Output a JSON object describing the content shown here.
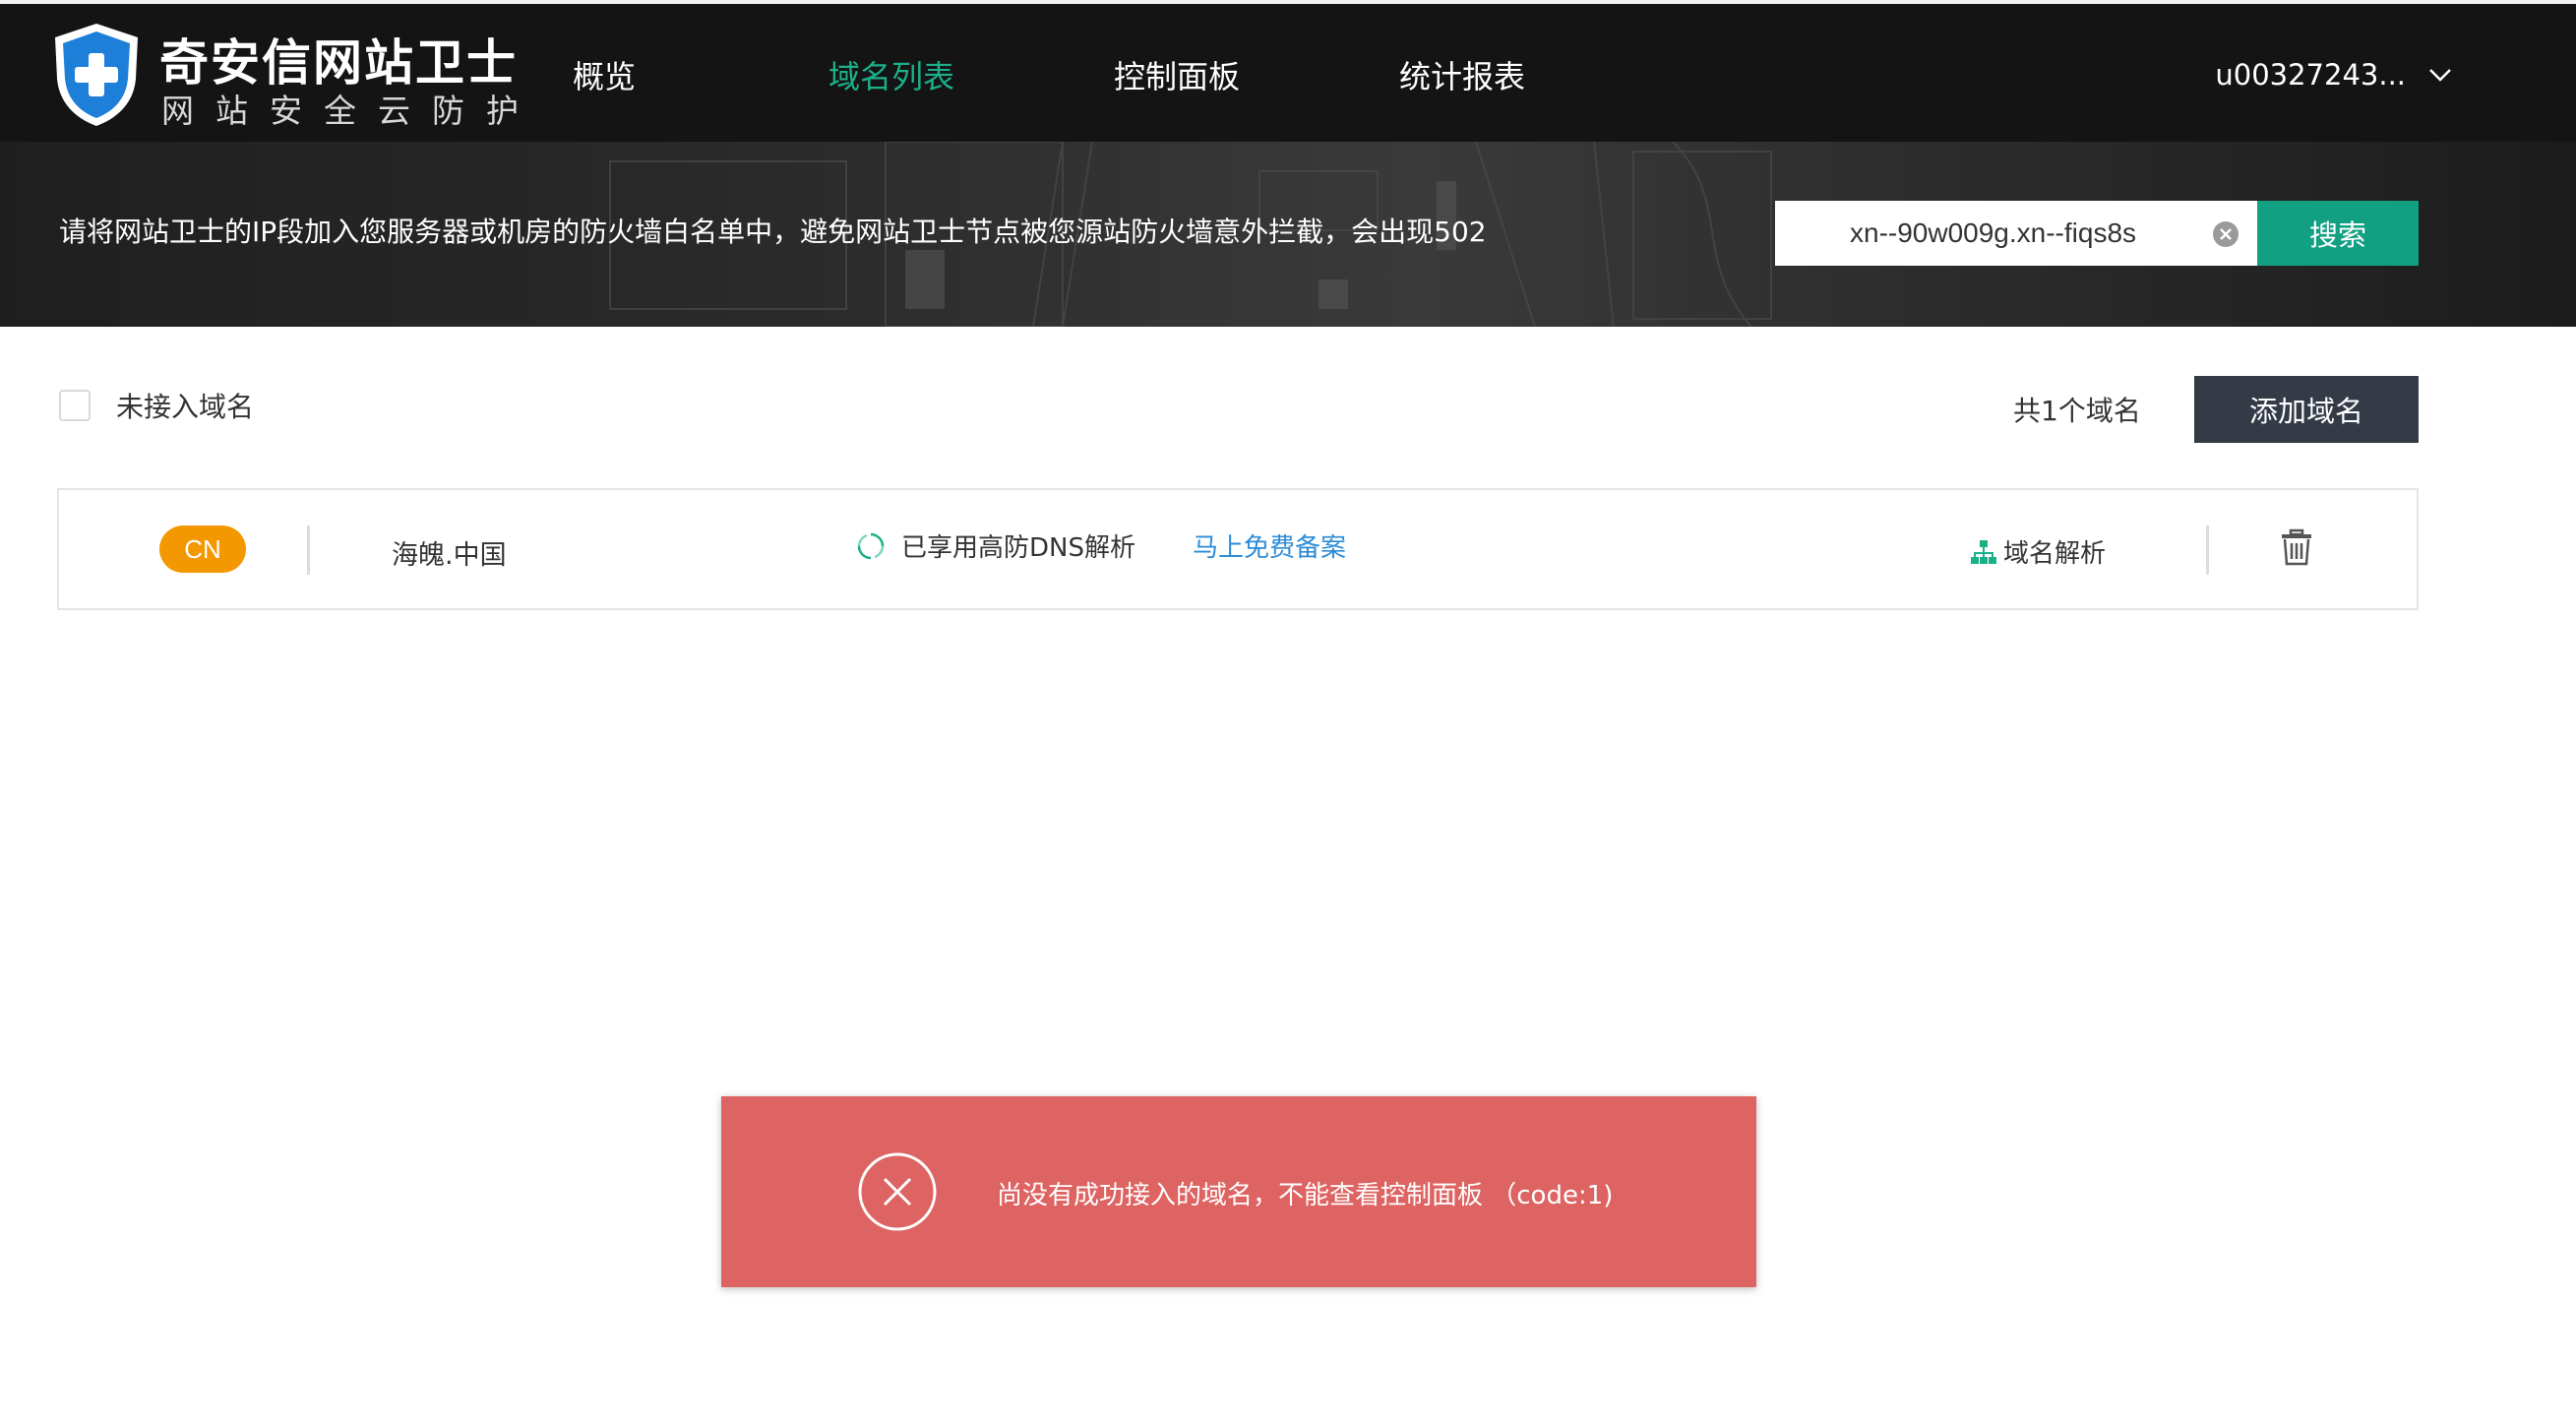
{
  "header": {
    "logo_title": "奇安信网站卫士",
    "logo_subtitle": "网站安全云防护",
    "nav": [
      {
        "label": "概览",
        "active": false
      },
      {
        "label": "域名列表",
        "active": true
      },
      {
        "label": "控制面板",
        "active": false
      },
      {
        "label": "统计报表",
        "active": false
      }
    ],
    "user_name": "u00327243..."
  },
  "banner": {
    "notice": "请将网站卫士的IP段加入您服务器或机房的防火墙白名单中，避免网站卫士节点被您源站防火墙意外拦截，会出现502",
    "search_value": "xn--90w009g.xn--fiqs8s",
    "search_button": "搜索"
  },
  "toolbar": {
    "unconnected_label": "未接入域名",
    "domain_count": "共1个域名",
    "add_domain_button": "添加域名"
  },
  "domains": [
    {
      "tld_badge": "CN",
      "name": "海魄.中国",
      "dns_status": "已享用高防DNS解析",
      "beian_link": "马上免费备案",
      "resolve_label": "域名解析"
    }
  ],
  "toast": {
    "message": "尚没有成功接入的域名，不能查看控制面板 （code:1)"
  },
  "colors": {
    "accent_green": "#1bb08a",
    "search_button": "#12a083",
    "add_button": "#343b47",
    "badge_orange": "#f39800",
    "link_blue": "#2d8cd6",
    "toast_red": "#dd6462"
  },
  "icons": [
    "shield-logo-icon",
    "chevron-down-icon",
    "clear-icon",
    "refresh-icon",
    "sitemap-icon",
    "trash-icon",
    "error-circle-icon"
  ]
}
